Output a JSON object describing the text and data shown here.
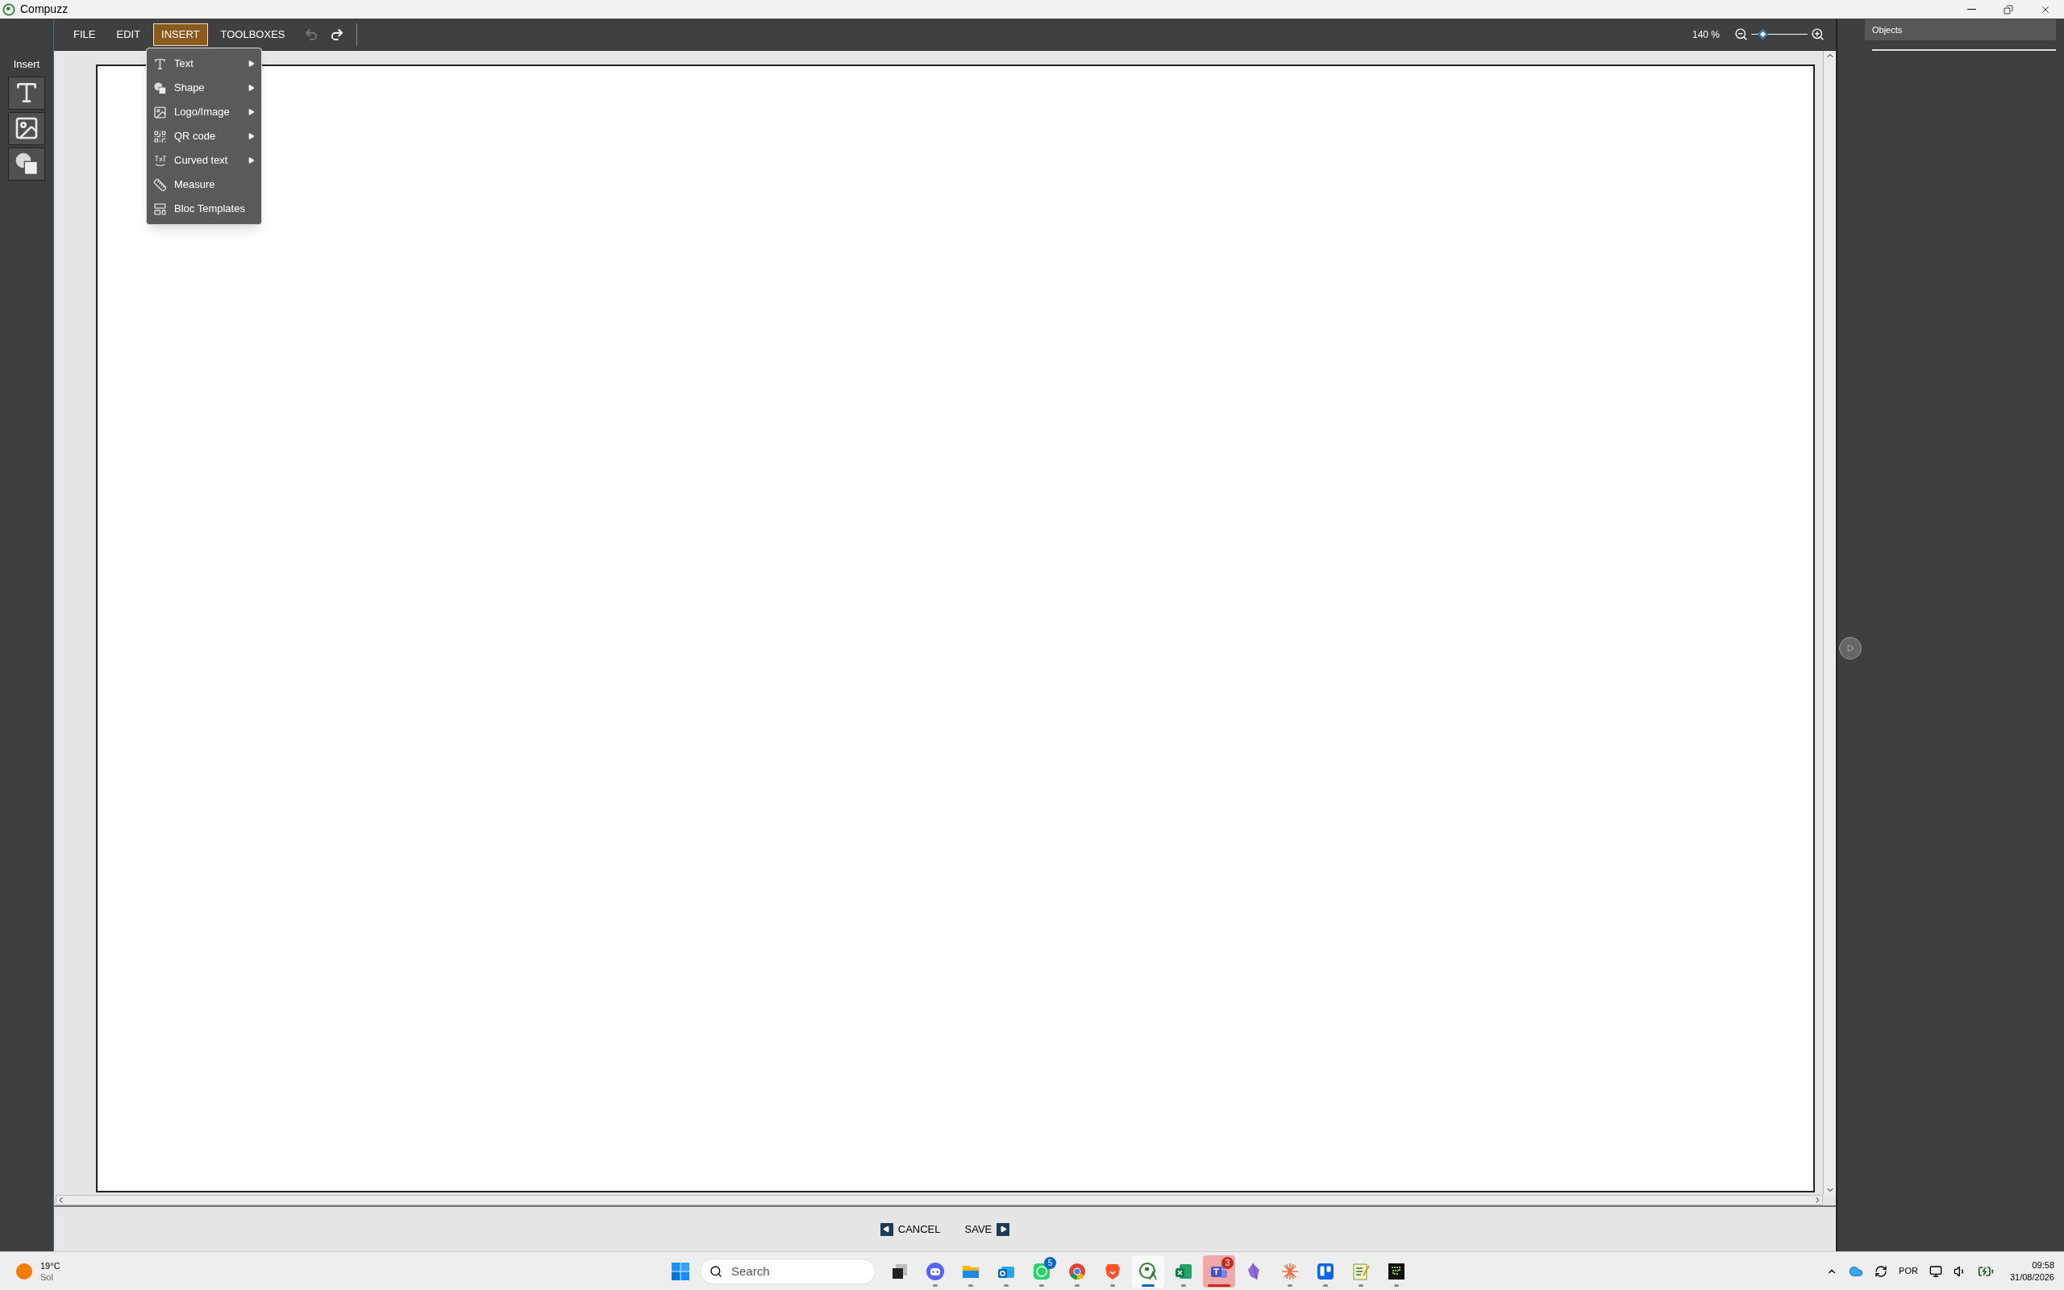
{
  "window": {
    "title": "Compuzz"
  },
  "menu_bar": [
    {
      "label": "FILE",
      "selected": false
    },
    {
      "label": "EDIT",
      "selected": false
    },
    {
      "label": "INSERT",
      "selected": true
    },
    {
      "label": "TOOLBOXES",
      "selected": false
    }
  ],
  "history": [
    {
      "kind": "undo",
      "disabled": true
    },
    {
      "kind": "redo",
      "disabled": false
    }
  ],
  "zoom": {
    "reading": "140 %",
    "level": 0.2
  },
  "sidebar": {
    "title": "Insert",
    "tools": [
      {
        "kind": "text"
      },
      {
        "kind": "image"
      },
      {
        "kind": "shape"
      }
    ]
  },
  "insert_menu": [
    {
      "kind": "text",
      "label": "Text",
      "submenu": true
    },
    {
      "kind": "shape",
      "label": "Shape",
      "submenu": true
    },
    {
      "kind": "image",
      "label": "Logo/Image",
      "submenu": true
    },
    {
      "kind": "qr",
      "label": "QR code",
      "submenu": true
    },
    {
      "kind": "curved",
      "label": "Curved text",
      "submenu": true
    },
    {
      "kind": "measure",
      "label": "Measure",
      "submenu": false
    },
    {
      "kind": "templates",
      "label": "Bloc Templates",
      "submenu": false
    }
  ],
  "objects_panel": {
    "title": "Objects"
  },
  "footer": {
    "cancel": "CANCEL",
    "save": "SAVE"
  },
  "taskbar": {
    "weather": {
      "temperature": "19°C",
      "condition": "Sol"
    },
    "search": {
      "placeholder": "Search"
    },
    "apps": [
      {
        "kind": "taskview",
        "running": false,
        "active": false,
        "alert": false
      },
      {
        "kind": "discord",
        "running": true,
        "active": false,
        "alert": false
      },
      {
        "kind": "files",
        "running": true,
        "active": false,
        "alert": false
      },
      {
        "kind": "outlook",
        "running": true,
        "active": false,
        "alert": false
      },
      {
        "kind": "whatsapp",
        "running": true,
        "active": false,
        "alert": false,
        "badge": "5"
      },
      {
        "kind": "chrome",
        "running": true,
        "active": false,
        "alert": false
      },
      {
        "kind": "brave",
        "running": true,
        "active": false,
        "alert": false
      },
      {
        "kind": "compuzz",
        "running": true,
        "active": true,
        "alert": false
      },
      {
        "kind": "excel",
        "running": true,
        "active": false,
        "alert": false
      },
      {
        "kind": "teams",
        "running": true,
        "active": false,
        "alert": true,
        "badge": "3"
      },
      {
        "kind": "crystal",
        "running": false,
        "active": false,
        "alert": false
      },
      {
        "kind": "spark",
        "running": true,
        "active": false,
        "alert": false
      },
      {
        "kind": "trello",
        "running": true,
        "active": false,
        "alert": false
      },
      {
        "kind": "notepad",
        "running": true,
        "active": false,
        "alert": false
      },
      {
        "kind": "terminal",
        "running": true,
        "active": false,
        "alert": false
      }
    ],
    "tray": {
      "language": "POR",
      "time": "09:58",
      "date": "31/08/2026"
    }
  }
}
